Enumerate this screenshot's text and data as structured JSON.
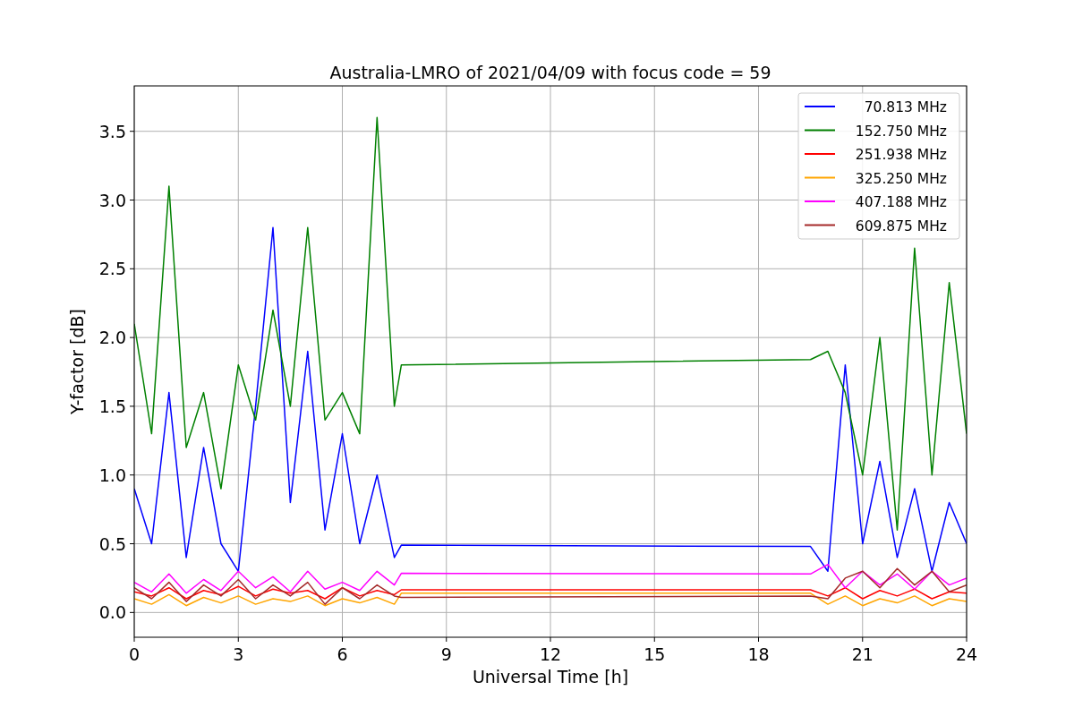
{
  "figure": {
    "chart_data": {
      "type": "line",
      "title": "Australia-LMRO of 2021/04/09 with focus code = 59",
      "xlabel": "Universal Time [h]",
      "ylabel": "Y-factor [dB]",
      "x": [
        0,
        0.5,
        1,
        1.5,
        2,
        2.5,
        3,
        3.5,
        4,
        4.5,
        5,
        5.5,
        6,
        6.5,
        7,
        7.5,
        7.7,
        19.5,
        20,
        20.5,
        21,
        21.5,
        22,
        22.5,
        23,
        23.5,
        24
      ],
      "series": [
        {
          "name": "70.813 MHz",
          "color": "#0000ff",
          "values": [
            0.9,
            0.5,
            1.6,
            0.4,
            1.2,
            0.5,
            0.3,
            1.5,
            2.8,
            0.8,
            1.9,
            0.6,
            1.3,
            0.5,
            1.0,
            0.4,
            0.49,
            0.48,
            0.3,
            1.8,
            0.5,
            1.1,
            0.4,
            0.9,
            0.3,
            0.8,
            0.5
          ]
        },
        {
          "name": "152.750 MHz",
          "color": "#008000",
          "values": [
            2.1,
            1.3,
            3.1,
            1.2,
            1.6,
            0.9,
            1.8,
            1.4,
            2.2,
            1.5,
            2.8,
            1.4,
            1.6,
            1.3,
            3.6,
            1.5,
            1.8,
            1.84,
            1.9,
            1.6,
            1.0,
            2.0,
            0.6,
            2.65,
            1.0,
            2.4,
            1.3
          ]
        },
        {
          "name": "251.938 MHz",
          "color": "#ff0000",
          "values": [
            0.15,
            0.12,
            0.18,
            0.1,
            0.16,
            0.13,
            0.19,
            0.12,
            0.17,
            0.14,
            0.16,
            0.1,
            0.18,
            0.12,
            0.16,
            0.13,
            0.165,
            0.165,
            0.12,
            0.18,
            0.1,
            0.16,
            0.12,
            0.17,
            0.1,
            0.15,
            0.14
          ]
        },
        {
          "name": "325.250 MHz",
          "color": "#ffa500",
          "values": [
            0.1,
            0.06,
            0.13,
            0.05,
            0.11,
            0.07,
            0.12,
            0.06,
            0.1,
            0.08,
            0.12,
            0.05,
            0.1,
            0.07,
            0.11,
            0.06,
            0.14,
            0.14,
            0.06,
            0.12,
            0.05,
            0.1,
            0.07,
            0.12,
            0.05,
            0.1,
            0.08
          ]
        },
        {
          "name": "407.188 MHz",
          "color": "#ff00ff",
          "values": [
            0.22,
            0.15,
            0.28,
            0.14,
            0.24,
            0.16,
            0.3,
            0.18,
            0.26,
            0.15,
            0.3,
            0.17,
            0.22,
            0.16,
            0.3,
            0.2,
            0.285,
            0.28,
            0.35,
            0.18,
            0.3,
            0.2,
            0.28,
            0.17,
            0.3,
            0.2,
            0.25
          ]
        },
        {
          "name": "609.875 MHz",
          "color": "#a52a2a",
          "values": [
            0.18,
            0.1,
            0.22,
            0.08,
            0.2,
            0.12,
            0.24,
            0.1,
            0.2,
            0.12,
            0.22,
            0.06,
            0.18,
            0.1,
            0.2,
            0.12,
            0.11,
            0.12,
            0.1,
            0.25,
            0.3,
            0.18,
            0.32,
            0.2,
            0.3,
            0.15,
            0.2
          ]
        }
      ],
      "grid": true,
      "legend": true,
      "xlim": [
        0,
        24
      ],
      "ylim": [
        -0.18,
        3.83
      ],
      "xticks": [
        0,
        3,
        6,
        9,
        12,
        15,
        18,
        21,
        24
      ],
      "yticks": [
        {
          "value": 0,
          "label": "0.0"
        },
        {
          "value": 0.5,
          "label": "0.5"
        },
        {
          "value": 1,
          "label": "1.0"
        },
        {
          "value": 1.5,
          "label": "1.5"
        },
        {
          "value": 2,
          "label": "2.0"
        },
        {
          "value": 2.5,
          "label": "2.5"
        },
        {
          "value": 3,
          "label": "3.0"
        },
        {
          "value": 3.5,
          "label": "3.5"
        }
      ]
    }
  }
}
